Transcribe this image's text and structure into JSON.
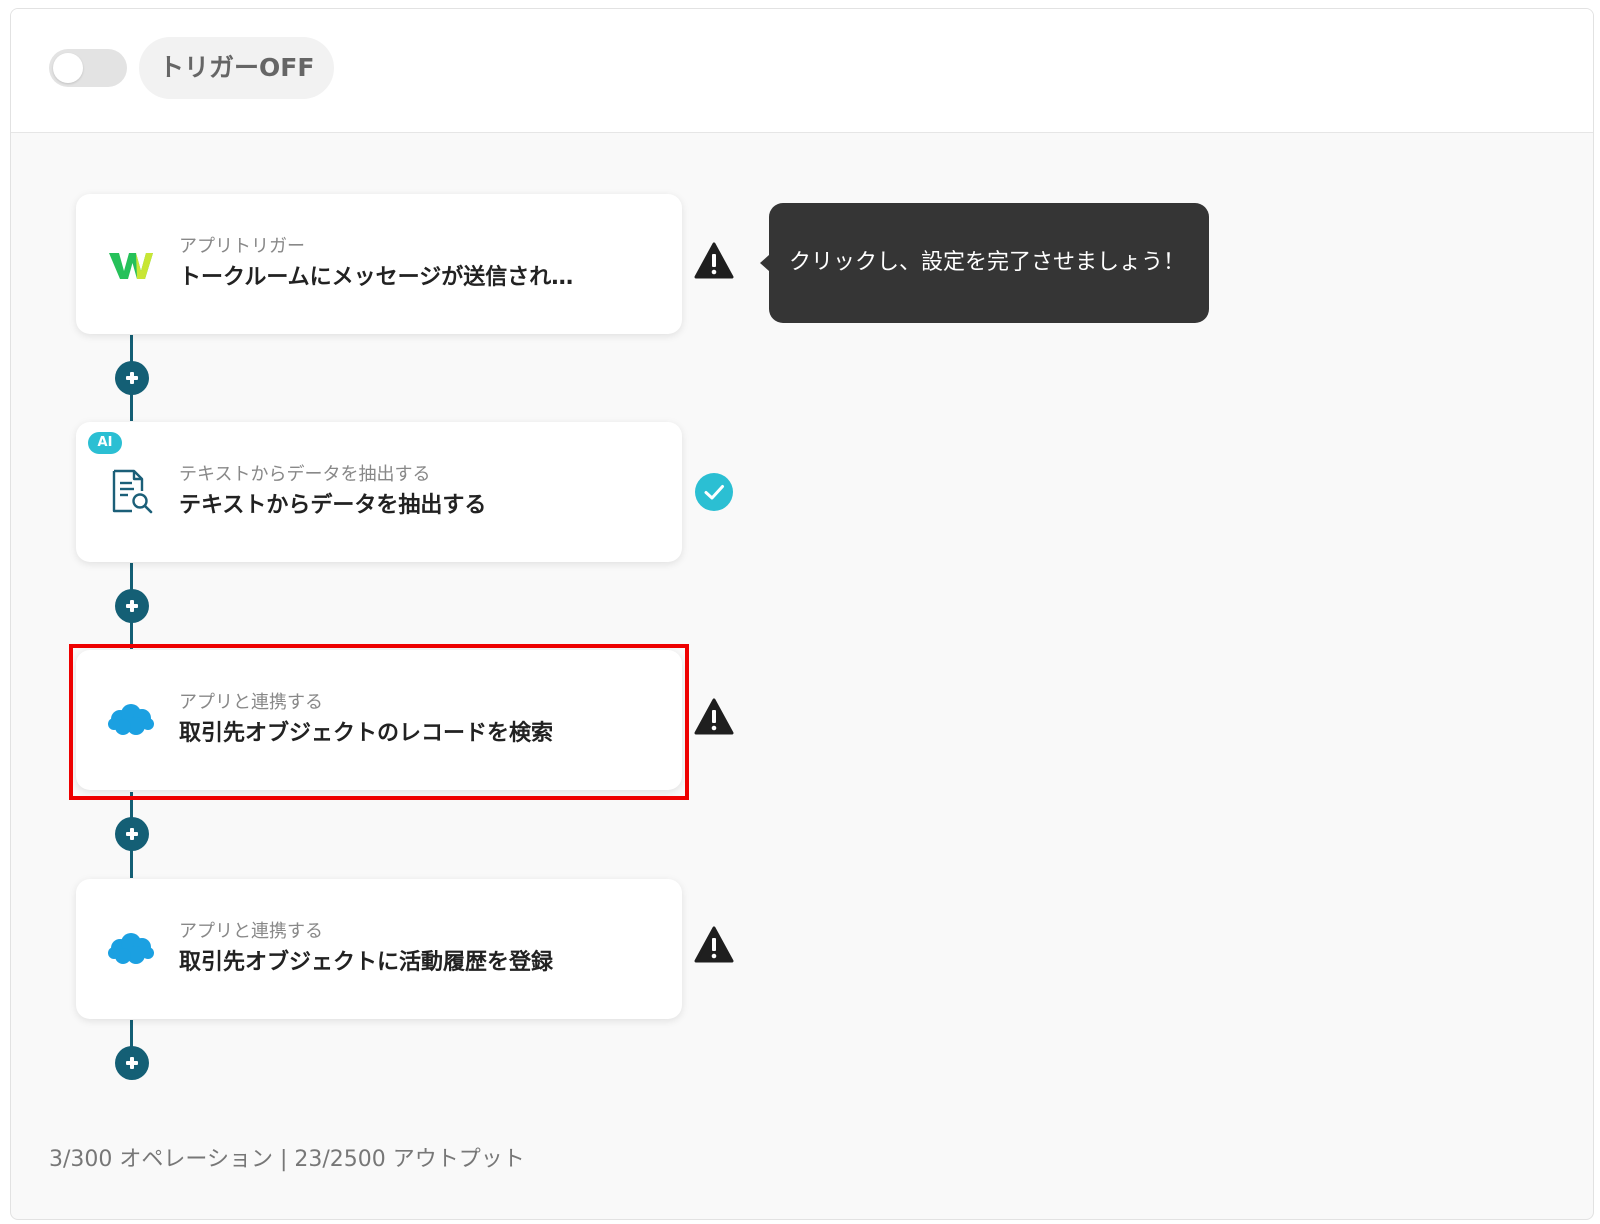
{
  "header": {
    "trigger_label": "トリガーOFF",
    "trigger_enabled": false
  },
  "tooltip": {
    "text": "クリックし、設定を完了させましょう！"
  },
  "steps": [
    {
      "subtitle": "アプリトリガー",
      "title": "トークルームにメッセージが送信され…",
      "app_icon": "w-logo-icon",
      "status": "warning-icon"
    },
    {
      "badge": "AI",
      "subtitle": "テキストからデータを抽出する",
      "title": "テキストからデータを抽出する",
      "app_icon": "document-search-icon",
      "status": "check-icon"
    },
    {
      "subtitle": "アプリと連携する",
      "title": "取引先オブジェクトのレコードを検索",
      "app_icon": "salesforce-cloud-icon",
      "status": "warning-icon",
      "highlighted": true
    },
    {
      "subtitle": "アプリと連携する",
      "title": "取引先オブジェクトに活動履歴を登録",
      "app_icon": "salesforce-cloud-icon",
      "status": "warning-icon"
    }
  ],
  "footer": {
    "usage": "3/300 オペレーション | 23/2500 アウトプット"
  },
  "colors": {
    "connector": "#145f75",
    "highlight": "#ee0000",
    "success": "#2bbfd3",
    "tooltip_bg": "#353535",
    "salesforce": "#1ba0e1"
  }
}
